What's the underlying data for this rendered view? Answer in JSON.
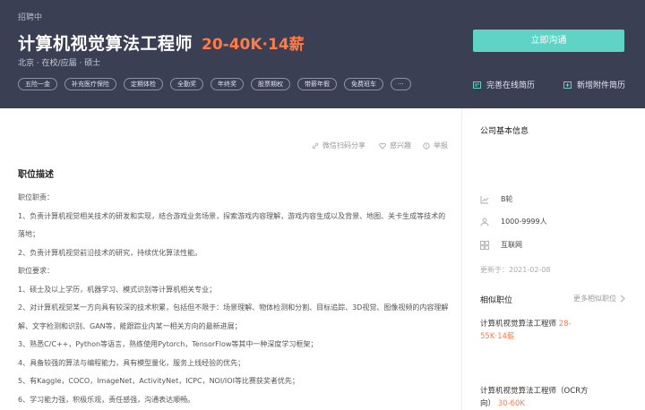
{
  "header": {
    "status": "招聘中",
    "title": "计算机视觉算法工程师",
    "salary": "20-40K·14薪",
    "meta": "北京 · 在校/应届 · 硕士",
    "tags": [
      "五险一金",
      "补充医疗保险",
      "定期体检",
      "全勤奖",
      "年终奖",
      "股票期权",
      "带薪年假",
      "免费班车",
      "···"
    ],
    "apply_label": "立即沟通",
    "improve_resume": "完善在线简历",
    "add_attachment": "新增附件简历"
  },
  "actions": {
    "share": "微信扫码分享",
    "interest": "感兴趣",
    "report": "举报"
  },
  "description": {
    "title": "职位描述",
    "lines": [
      "职位职责：",
      "1、负责计算机视觉相关技术的研发和实现，结合游戏业务场景，探索游戏内容理解，游戏内容生成以及背景、地图、关卡生成等技术的",
      "落地；",
      "2、负责计算机视觉前沿技术的研究，持续优化算法性能。",
      "职位要求：",
      "1、硕士及以上学历，机器学习、模式识别等计算机相关专业；",
      "2、对计算机视觉某一方向具有较深的技术积累，包括但不限于：场景理解、物体检测和分割、目标追踪、3D视觉、图像视频的内容理解",
      "解、文字检测和识别、GAN等，能跟踪业内某一相关方向的最新进展；",
      "3、熟悉C/C++，Python等语言，熟练使用Pytorch，TensorFlow等其中一种深度学习框架；",
      "4、具备较强的算法与编程能力，具有模型量化，服务上线经验的优先；",
      "5、有Kaggle，COCO，ImageNet，ActivityNet，ICPC，NOI/IOI等比赛获奖者优先；",
      "6、学习能力强，积极乐观，责任感强，沟通表达顺畅。"
    ]
  },
  "sidebar": {
    "company_info_title": "公司基本信息",
    "funding": "B轮",
    "size": "1000-9999人",
    "industry": "互联网",
    "updated": "更新于：2021-02-08",
    "similar_title": "相似职位",
    "more_label": "更多相似职位",
    "similar_jobs": [
      {
        "title": "计算机视觉算法工程师",
        "salary": "28-55K·14薪"
      },
      {
        "title": "计算机视觉算法工程师（OCR方向）",
        "salary": "30-60K"
      }
    ]
  },
  "colors": {
    "header_bg": "#3b3f54",
    "accent_salary": "#ff7a45",
    "apply_button": "#5fd3c5"
  }
}
